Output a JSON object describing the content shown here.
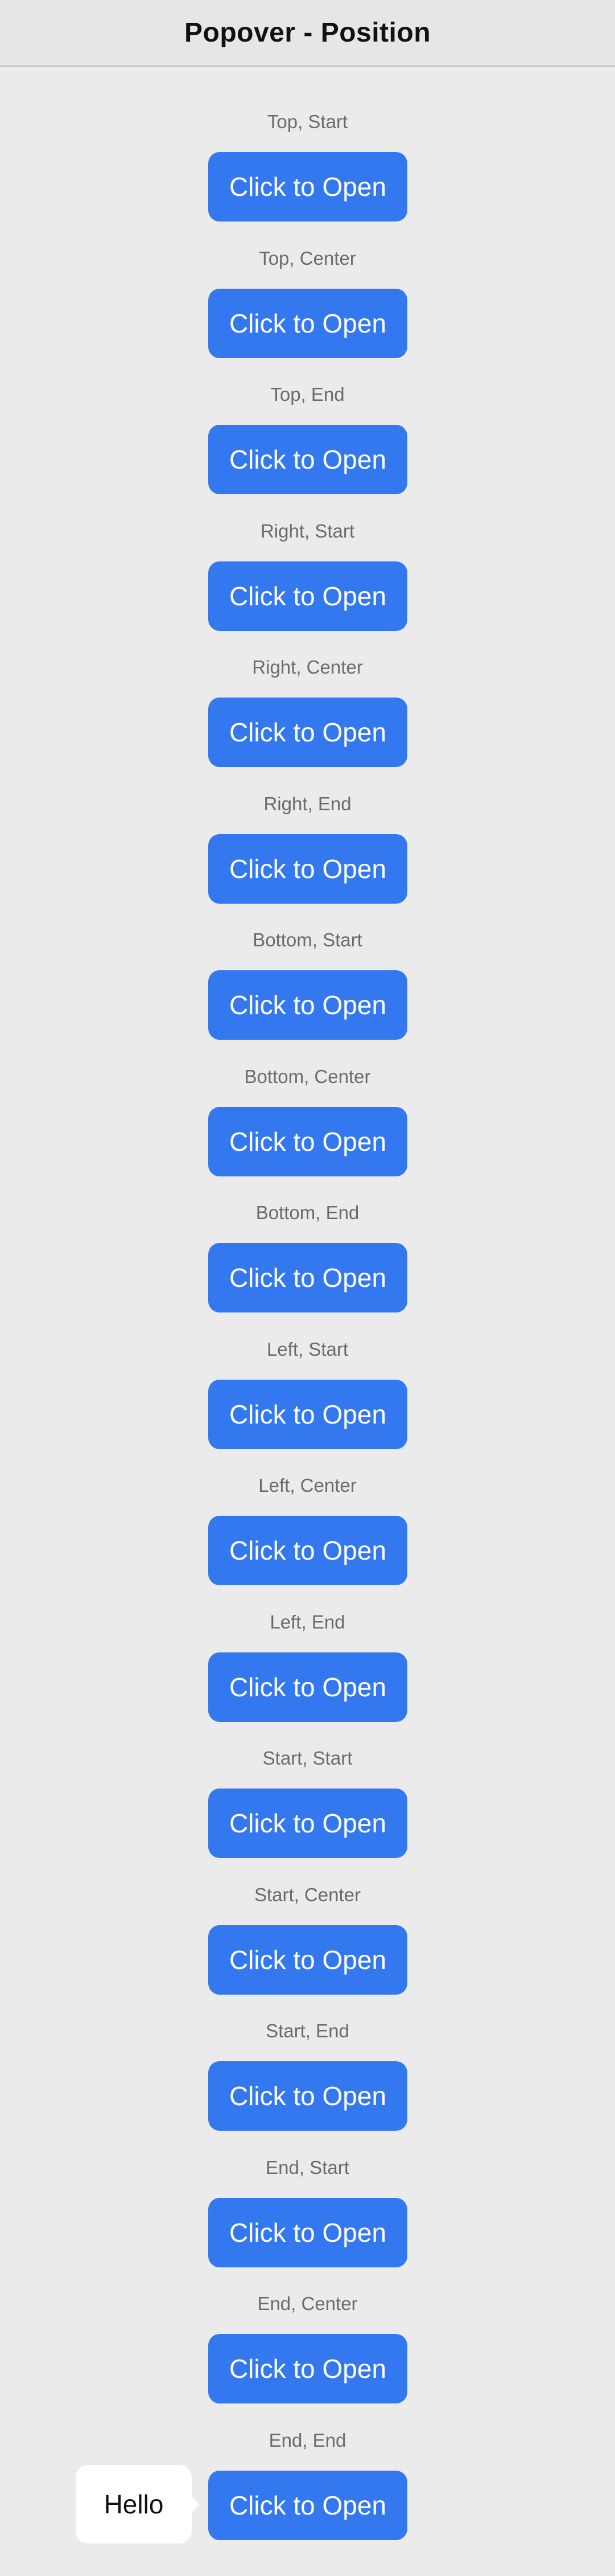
{
  "header": {
    "title": "Popover - Position"
  },
  "button_label": "Click to Open",
  "items": [
    {
      "label": "Top, Start"
    },
    {
      "label": "Top, Center"
    },
    {
      "label": "Top, End"
    },
    {
      "label": "Right, Start"
    },
    {
      "label": "Right, Center"
    },
    {
      "label": "Right, End"
    },
    {
      "label": "Bottom, Start"
    },
    {
      "label": "Bottom, Center"
    },
    {
      "label": "Bottom, End"
    },
    {
      "label": "Left, Start"
    },
    {
      "label": "Left, Center"
    },
    {
      "label": "Left, End"
    },
    {
      "label": "Start, Start"
    },
    {
      "label": "Start, Center"
    },
    {
      "label": "Start, End"
    },
    {
      "label": "End, Start"
    },
    {
      "label": "End, Center"
    },
    {
      "label": "End, End"
    }
  ],
  "popover": {
    "text": "Hello"
  },
  "colors": {
    "accent": "#3478f0",
    "background": "#ebebeb"
  }
}
